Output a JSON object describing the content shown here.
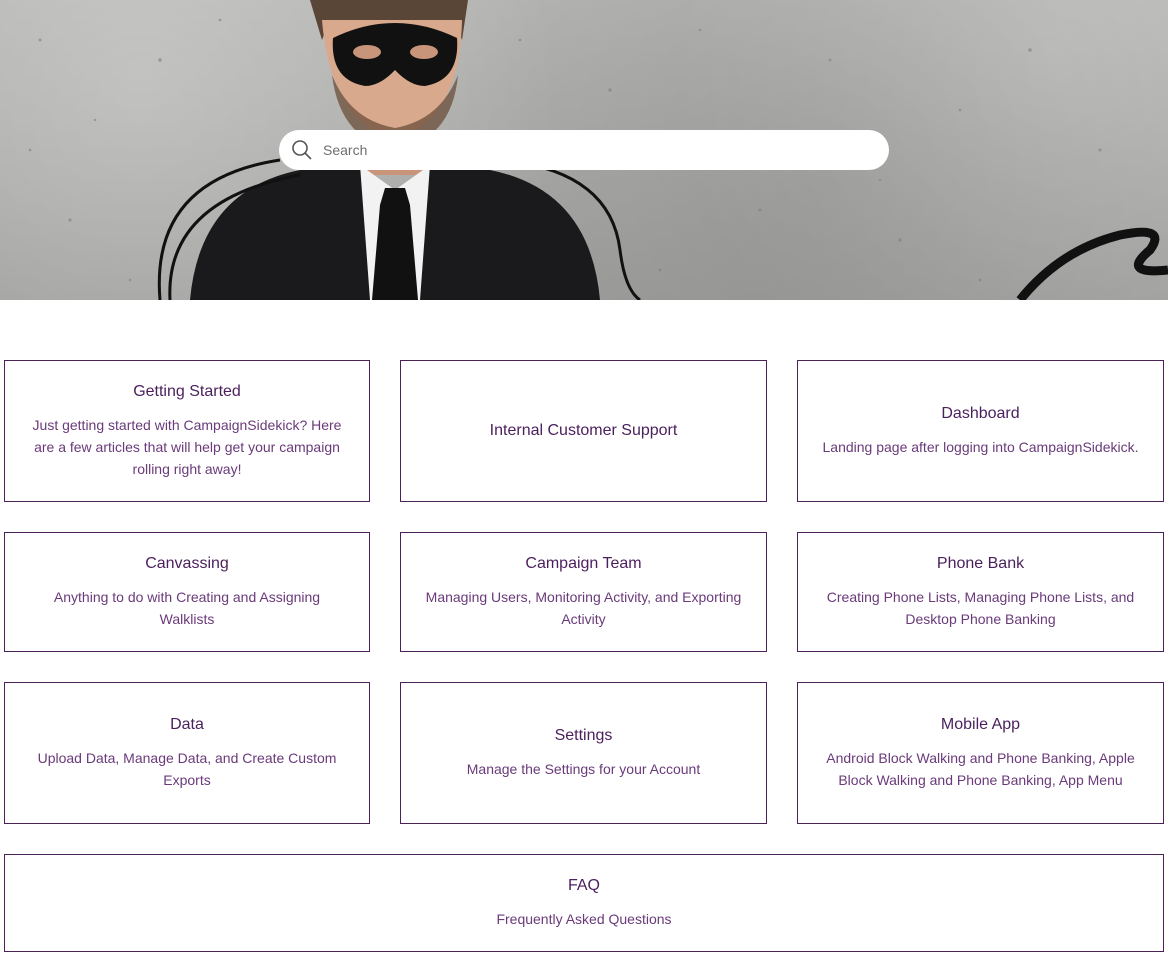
{
  "search": {
    "placeholder": "Search",
    "icon": "search-icon"
  },
  "colors": {
    "card_border": "#4a2258",
    "card_title": "#4a1f5c",
    "card_desc": "#6a3a7a"
  },
  "categories": [
    {
      "title": "Getting Started",
      "description": "Just getting started with CampaignSidekick? Here are a few articles that will help get your campaign rolling right away!"
    },
    {
      "title": "Internal Customer Support",
      "description": ""
    },
    {
      "title": "Dashboard",
      "description": "Landing page after logging into CampaignSidekick."
    },
    {
      "title": "Canvassing",
      "description": "Anything to do with Creating and Assigning Walklists"
    },
    {
      "title": "Campaign Team",
      "description": "Managing Users, Monitoring Activity, and Exporting Activity"
    },
    {
      "title": "Phone Bank",
      "description": "Creating Phone Lists, Managing Phone Lists, and Desktop Phone Banking"
    },
    {
      "title": "Data",
      "description": "Upload Data, Manage Data, and Create Custom Exports"
    },
    {
      "title": "Settings",
      "description": "Manage the Settings for your Account"
    },
    {
      "title": "Mobile App",
      "description": "Android Block Walking and Phone Banking, Apple Block Walking and Phone Banking, App Menu"
    },
    {
      "title": "FAQ",
      "description": "Frequently Asked Questions"
    }
  ]
}
